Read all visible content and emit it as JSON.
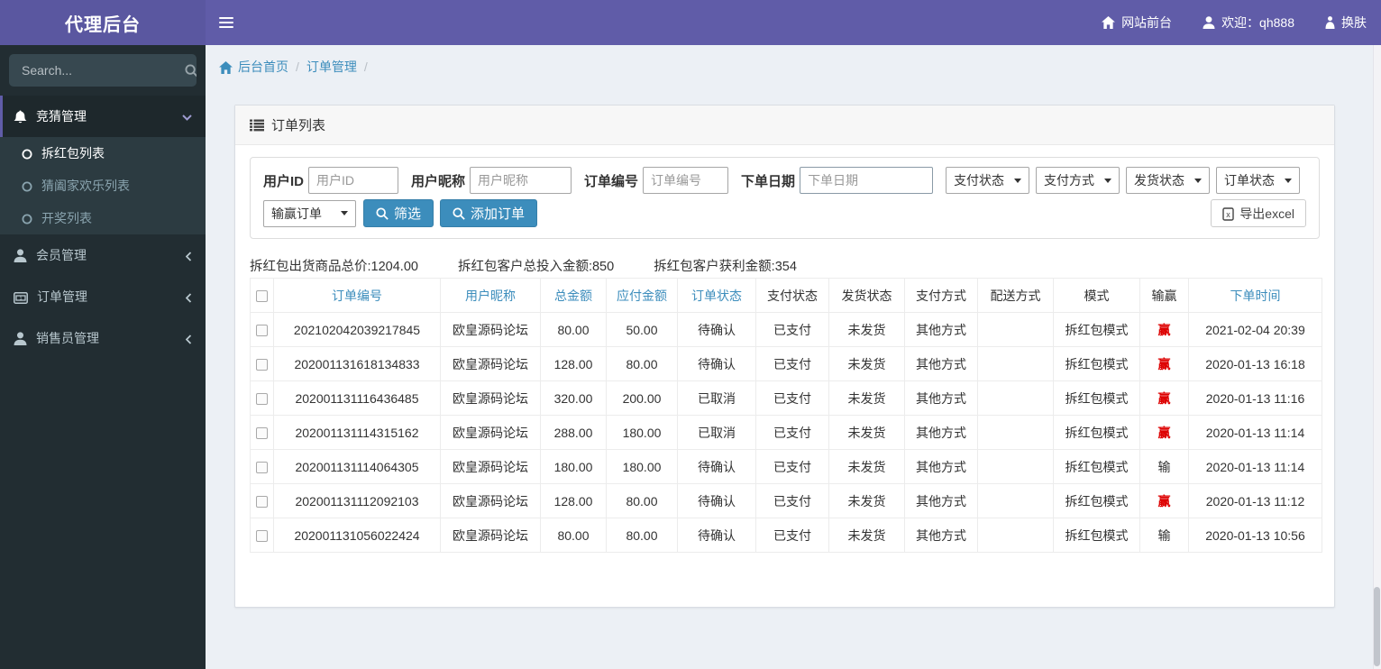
{
  "app": {
    "title": "代理后台"
  },
  "navbar": {
    "site_front": "网站前台",
    "welcome": "欢迎：qh888",
    "change_skin": "换肤"
  },
  "sidebar": {
    "search_placeholder": "Search...",
    "menu": [
      {
        "label": "竞猜管理",
        "icon": "bell-icon",
        "state": "expanded"
      },
      {
        "label": "会员管理",
        "icon": "user-icon",
        "state": "collapsed"
      },
      {
        "label": "订单管理",
        "icon": "credit-card-icon",
        "state": "collapsed"
      },
      {
        "label": "销售员管理",
        "icon": "user-icon",
        "state": "collapsed"
      }
    ],
    "submenu": [
      {
        "label": "拆红包列表",
        "active": true
      },
      {
        "label": "猜阖家欢乐列表",
        "active": false
      },
      {
        "label": "开奖列表",
        "active": false
      }
    ]
  },
  "breadcrumb": {
    "home": "后台首页",
    "current": "订单管理",
    "separator": "/"
  },
  "panel": {
    "title": "订单列表"
  },
  "filters": {
    "user_id_label": "用户ID",
    "user_id_placeholder": "用户ID",
    "nickname_label": "用户昵称",
    "nickname_placeholder": "用户昵称",
    "order_no_label": "订单编号",
    "order_no_placeholder": "订单编号",
    "date_label": "下单日期",
    "date_placeholder": "下单日期",
    "select_pay_status": "支付状态",
    "select_pay_method": "支付方式",
    "select_ship_status": "发货状态",
    "select_order_status": "订单状态",
    "select_winloss": "输赢订单",
    "filter_button": "筛选",
    "add_order_button": "添加订单",
    "export_button": "导出excel"
  },
  "summary": {
    "total_goods": "拆红包出货商品总价:1204.00",
    "total_invested": "拆红包客户总投入金额:850",
    "total_profit": "拆红包客户获利金额:354"
  },
  "table": {
    "columns": {
      "order_no": "订单编号",
      "nickname": "用户昵称",
      "total": "总金额",
      "payable": "应付金额",
      "order_status": "订单状态",
      "pay_status": "支付状态",
      "ship_status": "发货状态",
      "pay_method": "支付方式",
      "delivery": "配送方式",
      "mode": "模式",
      "winloss": "输赢",
      "time": "下单时间"
    },
    "rows": [
      {
        "order_no": "202102042039217845",
        "nickname": "欧皇源码论坛",
        "total": "80.00",
        "payable": "50.00",
        "order_status": "待确认",
        "pay_status": "已支付",
        "ship_status": "未发货",
        "pay_method": "其他方式",
        "delivery": "",
        "mode": "拆红包模式",
        "winloss": "赢",
        "win": true,
        "time": "2021-02-04 20:39"
      },
      {
        "order_no": "202001131618134833",
        "nickname": "欧皇源码论坛",
        "total": "128.00",
        "payable": "80.00",
        "order_status": "待确认",
        "pay_status": "已支付",
        "ship_status": "未发货",
        "pay_method": "其他方式",
        "delivery": "",
        "mode": "拆红包模式",
        "winloss": "赢",
        "win": true,
        "time": "2020-01-13 16:18"
      },
      {
        "order_no": "202001131116436485",
        "nickname": "欧皇源码论坛",
        "total": "320.00",
        "payable": "200.00",
        "order_status": "已取消",
        "pay_status": "已支付",
        "ship_status": "未发货",
        "pay_method": "其他方式",
        "delivery": "",
        "mode": "拆红包模式",
        "winloss": "赢",
        "win": true,
        "time": "2020-01-13 11:16"
      },
      {
        "order_no": "202001131114315162",
        "nickname": "欧皇源码论坛",
        "total": "288.00",
        "payable": "180.00",
        "order_status": "已取消",
        "pay_status": "已支付",
        "ship_status": "未发货",
        "pay_method": "其他方式",
        "delivery": "",
        "mode": "拆红包模式",
        "winloss": "赢",
        "win": true,
        "time": "2020-01-13 11:14"
      },
      {
        "order_no": "202001131114064305",
        "nickname": "欧皇源码论坛",
        "total": "180.00",
        "payable": "180.00",
        "order_status": "待确认",
        "pay_status": "已支付",
        "ship_status": "未发货",
        "pay_method": "其他方式",
        "delivery": "",
        "mode": "拆红包模式",
        "winloss": "输",
        "win": false,
        "time": "2020-01-13 11:14"
      },
      {
        "order_no": "202001131112092103",
        "nickname": "欧皇源码论坛",
        "total": "128.00",
        "payable": "80.00",
        "order_status": "待确认",
        "pay_status": "已支付",
        "ship_status": "未发货",
        "pay_method": "其他方式",
        "delivery": "",
        "mode": "拆红包模式",
        "winloss": "赢",
        "win": true,
        "time": "2020-01-13 11:12"
      },
      {
        "order_no": "202001131056022424",
        "nickname": "欧皇源码论坛",
        "total": "80.00",
        "payable": "80.00",
        "order_status": "待确认",
        "pay_status": "已支付",
        "ship_status": "未发货",
        "pay_method": "其他方式",
        "delivery": "",
        "mode": "拆红包模式",
        "winloss": "输",
        "win": false,
        "time": "2020-01-13 10:56"
      }
    ]
  },
  "colors": {
    "navbar_purple": "#605ca8",
    "sidebar_dark": "#222d32",
    "submenu_bg": "#2c3b41",
    "accent_blue": "#3c8dbc",
    "win_red": "#dd0000",
    "content_bg": "#ecf0f5"
  }
}
